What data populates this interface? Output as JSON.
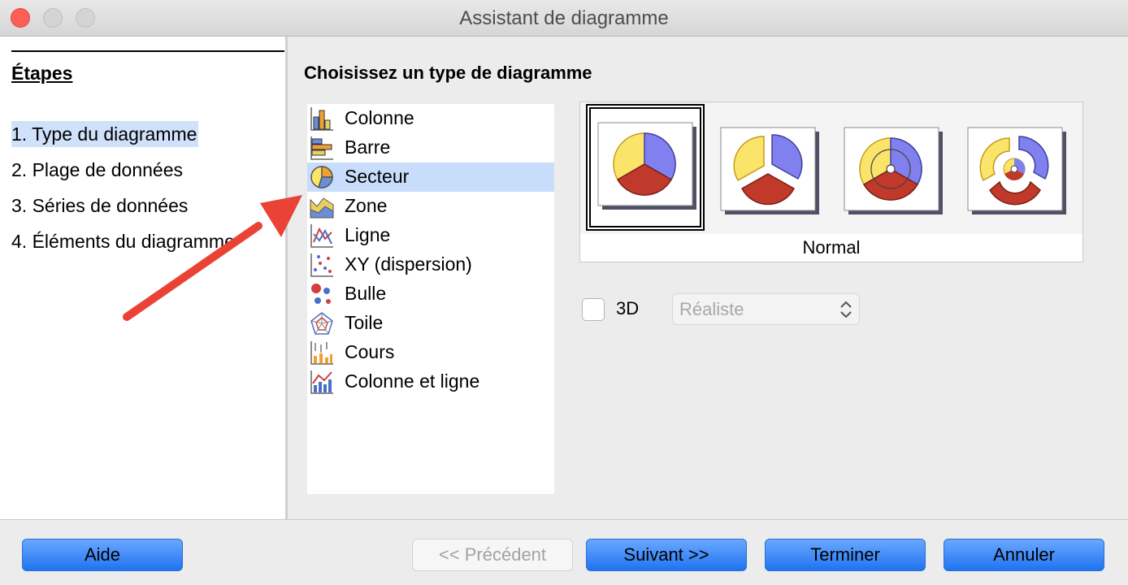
{
  "window": {
    "title": "Assistant de diagramme",
    "controls": [
      "close-button",
      "minimize-button",
      "zoom-button"
    ]
  },
  "steps": {
    "heading": "Étapes",
    "items": [
      {
        "label": "1. Type du diagramme",
        "active": true
      },
      {
        "label": "2. Plage de données",
        "active": false
      },
      {
        "label": "3. Séries de données",
        "active": false
      },
      {
        "label": "4. Éléments du diagramme",
        "active": false
      }
    ]
  },
  "main": {
    "heading": "Choisissez un type de diagramme",
    "chart_types": [
      {
        "label": "Colonne",
        "icon": "column-chart-icon",
        "selected": false
      },
      {
        "label": "Barre",
        "icon": "bar-chart-icon",
        "selected": false
      },
      {
        "label": "Secteur",
        "icon": "pie-chart-icon",
        "selected": true
      },
      {
        "label": "Zone",
        "icon": "area-chart-icon",
        "selected": false
      },
      {
        "label": "Ligne",
        "icon": "line-chart-icon",
        "selected": false
      },
      {
        "label": "XY (dispersion)",
        "icon": "scatter-chart-icon",
        "selected": false
      },
      {
        "label": "Bulle",
        "icon": "bubble-chart-icon",
        "selected": false
      },
      {
        "label": "Toile",
        "icon": "net-chart-icon",
        "selected": false
      },
      {
        "label": "Cours",
        "icon": "stock-chart-icon",
        "selected": false
      },
      {
        "label": "Colonne et ligne",
        "icon": "column-line-chart-icon",
        "selected": false
      }
    ],
    "variants": {
      "selected_label": "Normal",
      "items": [
        "pie-normal-icon",
        "pie-exploded-icon",
        "donut-icon",
        "donut-exploded-icon"
      ]
    },
    "option_3d": {
      "label": "3D",
      "checked": false
    },
    "shape_select": {
      "value": "Réaliste",
      "enabled": false
    }
  },
  "buttons": {
    "help": "Aide",
    "previous": "<< Précédent",
    "next": "Suivant >>",
    "finish": "Terminer",
    "cancel": "Annuler"
  },
  "colors": {
    "pie_yellow": "#fbe46a",
    "pie_blue": "#8080ee",
    "pie_red": "#c0392b",
    "selection": "#c8ddfb",
    "annotation_arrow": "#ea4335",
    "button_blue": "#2a77f2"
  }
}
